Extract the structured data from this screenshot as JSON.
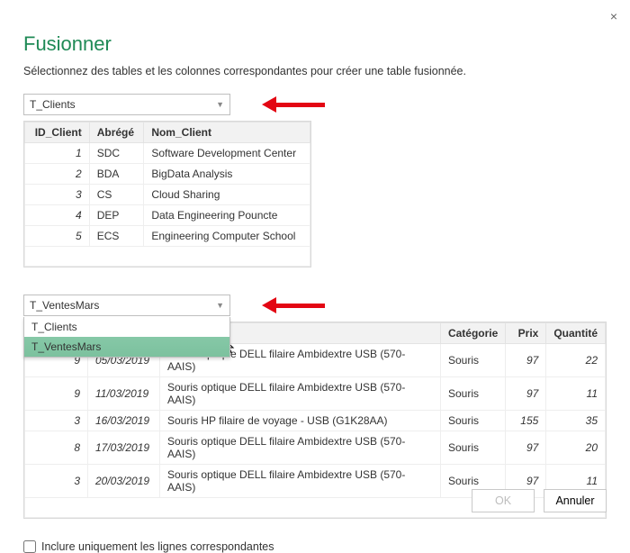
{
  "close_label": "×",
  "title": "Fusionner",
  "subtitle": "Sélectionnez des tables et les colonnes correspondantes pour créer une table fusionnée.",
  "dropdown1": {
    "value": "T_Clients"
  },
  "table1": {
    "headers": [
      "ID_Client",
      "Abrégé",
      "Nom_Client"
    ],
    "rows": [
      [
        "1",
        "SDC",
        "Software Development Center"
      ],
      [
        "2",
        "BDA",
        "BigData Analysis"
      ],
      [
        "3",
        "CS",
        "Cloud Sharing"
      ],
      [
        "4",
        "DEP",
        "Data Engineering Pouncte"
      ],
      [
        "5",
        "ECS",
        "Engineering Computer School"
      ]
    ]
  },
  "dropdown2": {
    "value": "T_VentesMars",
    "options": [
      "T_Clients",
      "T_VentesMars"
    ],
    "selected_index": 1
  },
  "table2": {
    "headers": [
      "",
      "",
      "",
      "Catégorie",
      "Prix",
      "Quantité"
    ],
    "rows": [
      [
        "9",
        "05/03/2019",
        "Souris optique DELL filaire Ambidextre USB (570-AAIS)",
        "Souris",
        "97",
        "22"
      ],
      [
        "9",
        "11/03/2019",
        "Souris optique DELL filaire Ambidextre USB (570-AAIS)",
        "Souris",
        "97",
        "11"
      ],
      [
        "3",
        "16/03/2019",
        "Souris HP filaire de voyage - USB (G1K28AA)",
        "Souris",
        "155",
        "35"
      ],
      [
        "8",
        "17/03/2019",
        "Souris optique DELL filaire Ambidextre USB (570-AAIS)",
        "Souris",
        "97",
        "20"
      ],
      [
        "3",
        "20/03/2019",
        "Souris optique DELL filaire Ambidextre USB (570-AAIS)",
        "Souris",
        "97",
        "11"
      ]
    ]
  },
  "checkbox_label": "Inclure uniquement les lignes correspondantes",
  "buttons": {
    "ok": "OK",
    "cancel": "Annuler"
  }
}
